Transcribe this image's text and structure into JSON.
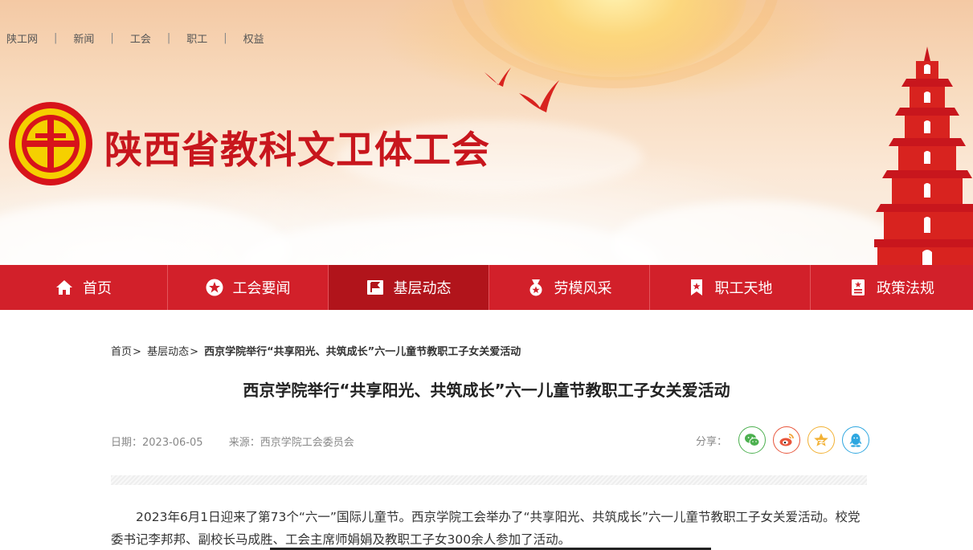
{
  "top_links": [
    "陕工网",
    "新闻",
    "工会",
    "职工",
    "权益"
  ],
  "site": {
    "title": "陕西省教科文卫体工会"
  },
  "nav": {
    "items": [
      {
        "label": "首页",
        "icon": "home-icon"
      },
      {
        "label": "工会要闻",
        "icon": "star-circle-icon"
      },
      {
        "label": "基层动态",
        "icon": "flag-icon",
        "active": true
      },
      {
        "label": "劳模风采",
        "icon": "medal-icon"
      },
      {
        "label": "职工天地",
        "icon": "bookmark-star-icon"
      },
      {
        "label": "政策法规",
        "icon": "document-star-icon"
      }
    ]
  },
  "breadcrumb": {
    "home": "首页",
    "section": "基层动态",
    "sep": ">",
    "current": "西京学院举行“共享阳光、共筑成长”六一儿童节教职工子女关爱活动"
  },
  "article": {
    "title": "西京学院举行“共享阳光、共筑成长”六一儿童节教职工子女关爱活动",
    "date_label": "日期：",
    "date": "2023-06-05",
    "source_label": "来源：",
    "source": "西京学院工会委员会",
    "paragraph": "2023年6月1日迎来了第73个“六一”国际儿童节。西京学院工会举办了“共享阳光、共筑成长”六一儿童节教职工子女关爱活动。校党委书记李邦邦、副校长马成胜、工会主席师娟娟及教职工子女300余人参加了活动。"
  },
  "share": {
    "label": "分享：",
    "buttons": [
      {
        "name": "wechat",
        "icon": "wechat-icon",
        "color": "#4cb04f"
      },
      {
        "name": "weibo",
        "icon": "weibo-icon",
        "color": "#e8553b"
      },
      {
        "name": "qzone",
        "icon": "qzone-star-icon",
        "color": "#f2b134"
      },
      {
        "name": "qq",
        "icon": "qq-icon",
        "color": "#2ea7e0"
      }
    ]
  },
  "colors": {
    "brand_red": "#d2202a",
    "active_nav": "#b1141b",
    "title_red": "#c8161d"
  }
}
